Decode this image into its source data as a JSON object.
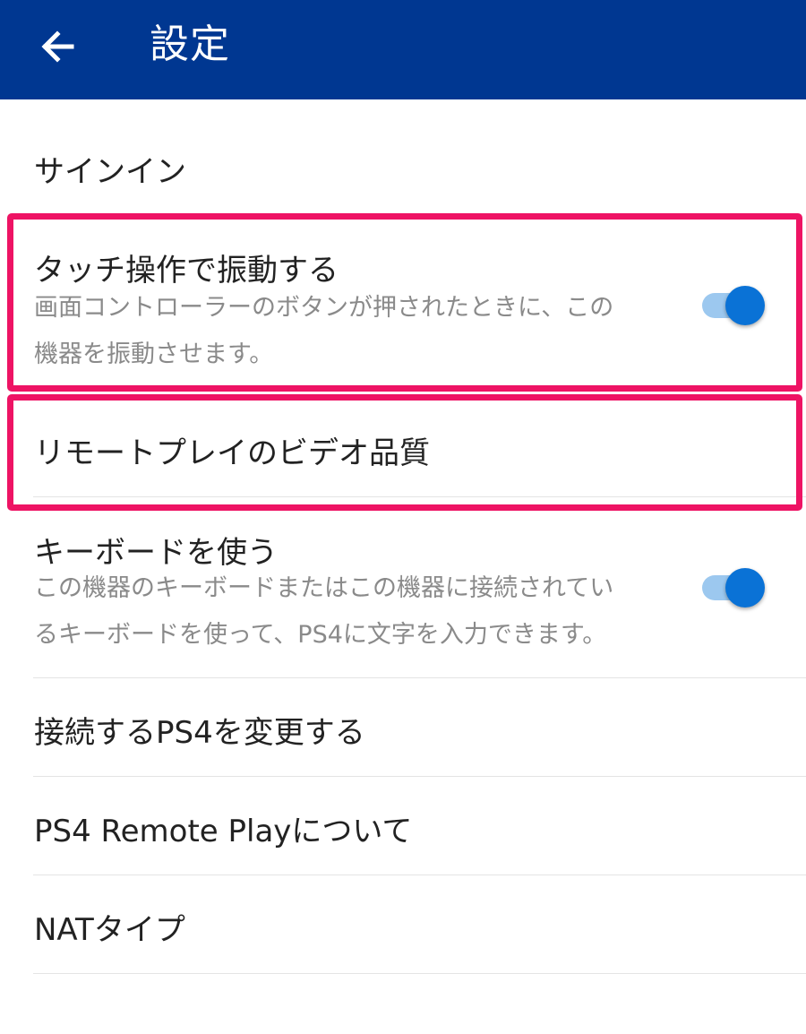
{
  "app_bar": {
    "title": "設定",
    "back_icon": "arrow-left-icon",
    "background": "#003791"
  },
  "settings": {
    "sign_in": {
      "label": "サインイン"
    },
    "vibration": {
      "label": "タッチ操作で振動する",
      "description_line1": "画面コントローラーのボタンが押されたときに、この",
      "description_line2": "機器を振動させます。",
      "enabled": true
    },
    "video_quality": {
      "label": "リモートプレイのビデオ品質"
    },
    "keyboard": {
      "label": "キーボードを使う",
      "description_line1": "この機器のキーボードまたはこの機器に接続されてい",
      "description_line2": "るキーボードを使って、PS4に文字を入力できます。",
      "enabled": true
    },
    "change_ps4": {
      "label": "接続するPS4を変更する"
    },
    "about": {
      "label": "PS4 Remote Playについて"
    },
    "nat_type": {
      "label": "NATタイプ"
    }
  },
  "colors": {
    "highlight_border": "#ee1364",
    "toggle_knob": "#0a72d6",
    "toggle_track": "#9cc8ef"
  }
}
